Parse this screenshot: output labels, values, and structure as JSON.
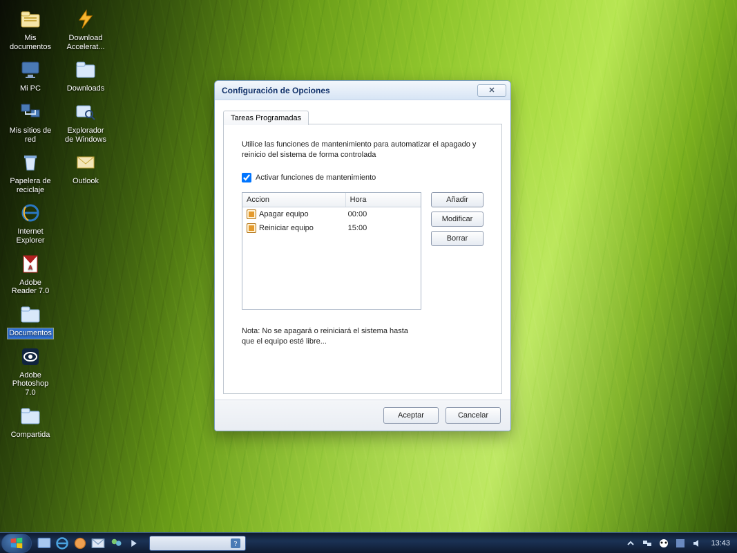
{
  "desktop": {
    "icons": [
      {
        "id": "mydocs",
        "label": "Mis documentos",
        "glyph": "folder-docs"
      },
      {
        "id": "dla",
        "label": "Download Accelerat...",
        "glyph": "bolt"
      },
      {
        "id": "mypc",
        "label": "Mi PC",
        "glyph": "monitor"
      },
      {
        "id": "dls",
        "label": "Downloads",
        "glyph": "folder"
      },
      {
        "id": "netpl",
        "label": "Mis sitios de red",
        "glyph": "net"
      },
      {
        "id": "explorer",
        "label": "Explorador de Windows",
        "glyph": "search"
      },
      {
        "id": "recycle",
        "label": "Papelera de reciclaje",
        "glyph": "bin"
      },
      {
        "id": "outlook",
        "label": "Outlook",
        "glyph": "mail"
      },
      {
        "id": "ie",
        "label": "Internet Explorer",
        "glyph": "ie"
      },
      {
        "id": "blank1",
        "label": "",
        "glyph": ""
      },
      {
        "id": "reader",
        "label": "Adobe Reader 7.0",
        "glyph": "pdf"
      },
      {
        "id": "blank2",
        "label": "",
        "glyph": ""
      },
      {
        "id": "docsfold",
        "label": "Documentos",
        "glyph": "folder",
        "selected": true
      },
      {
        "id": "blank3",
        "label": "",
        "glyph": ""
      },
      {
        "id": "ps",
        "label": "Adobe Photoshop 7.0",
        "glyph": "eye"
      },
      {
        "id": "blank4",
        "label": "",
        "glyph": ""
      },
      {
        "id": "shared",
        "label": "Compartida",
        "glyph": "folder"
      }
    ]
  },
  "dialog": {
    "title": "Configuración de Opciones",
    "close_glyph": "✕",
    "tab_label": "Tareas Programadas",
    "intro": "Utilice las funciones de mantenimiento para automatizar el apagado y reinicio del sistema de forma controlada",
    "checkbox_label": "Activar funciones de mantenimiento",
    "checkbox_checked": true,
    "list": {
      "headers": {
        "action": "Accion",
        "time": "Hora"
      },
      "rows": [
        {
          "action": "Apagar equipo",
          "time": "00:00"
        },
        {
          "action": "Reiniciar equipo",
          "time": "15:00"
        }
      ]
    },
    "buttons": {
      "add": "Añadir",
      "edit": "Modificar",
      "del": "Borrar"
    },
    "note": "Nota: No se apagará o reiniciará el sistema hasta que el equipo esté libre...",
    "ok": "Aceptar",
    "cancel": "Cancelar"
  },
  "taskbar": {
    "clock": "13:43"
  }
}
